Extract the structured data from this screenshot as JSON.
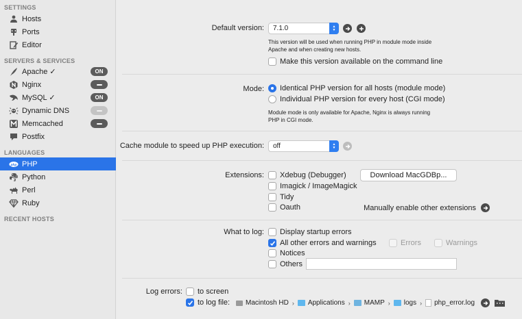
{
  "sidebar": {
    "settings_title": "SETTINGS",
    "settings_items": [
      {
        "label": "Hosts",
        "icon": "hosts-icon"
      },
      {
        "label": "Ports",
        "icon": "ports-icon"
      },
      {
        "label": "Editor",
        "icon": "editor-icon"
      }
    ],
    "servers_title": "SERVERS & SERVICES",
    "servers": [
      {
        "label": "Apache ✓",
        "status": "ON"
      },
      {
        "label": "Nginx",
        "status": ""
      },
      {
        "label": "MySQL ✓",
        "status": "ON"
      },
      {
        "label": "Dynamic DNS",
        "status": ""
      },
      {
        "label": "Memcached",
        "status": ""
      },
      {
        "label": "Postfix",
        "status": ""
      }
    ],
    "languages_title": "LANGUAGES",
    "languages": [
      {
        "label": "PHP",
        "icon_text": "php"
      },
      {
        "label": "Python"
      },
      {
        "label": "Perl"
      },
      {
        "label": "Ruby"
      }
    ],
    "recent_title": "RECENT HOSTS"
  },
  "php": {
    "default_version_label": "Default version:",
    "default_version_value": "7.1.0",
    "default_version_help_1": "This version will be used when running PHP in module mode inside",
    "default_version_help_2": "Apache and when creating new hosts.",
    "cli_checkbox": "Make this version available on the command line",
    "mode_label": "Mode:",
    "mode_options": [
      "Identical PHP version for all hosts (module mode)",
      "Individual PHP version for every host (CGI mode)"
    ],
    "mode_selected": 0,
    "mode_help_1": "Module mode is only available for Apache, Nginx is always running",
    "mode_help_2": "PHP in CGI mode.",
    "cache_label": "Cache module to speed up PHP execution:",
    "cache_value": "off",
    "extensions_label": "Extensions:",
    "extensions": [
      {
        "label": "Xdebug (Debugger)",
        "checked": false
      },
      {
        "label": "Imagick / ImageMagick",
        "checked": false
      },
      {
        "label": "Tidy",
        "checked": false
      },
      {
        "label": "Oauth",
        "checked": false
      }
    ],
    "download_button": "Download MacGDBp...",
    "manual_extensions": "Manually enable other extensions",
    "log_label": "What to log:",
    "log_options": [
      {
        "label": "Display startup errors",
        "checked": false
      },
      {
        "label": "All other errors and warnings",
        "checked": true
      },
      {
        "label": "Notices",
        "checked": false
      },
      {
        "label": "Others",
        "checked": false
      }
    ],
    "log_sub_errors": "Errors",
    "log_sub_warnings": "Warnings",
    "others_value": "",
    "log_errors_label": "Log errors:",
    "to_screen": "to screen",
    "to_screen_checked": false,
    "to_log_file": "to log file:",
    "to_log_file_checked": true,
    "path": [
      "Macintosh HD",
      "Applications",
      "MAMP",
      "logs",
      "php_error.log"
    ]
  },
  "colors": {
    "accent": "#2a74e8",
    "sidebar_bg": "#e8e8e8",
    "main_bg": "#ececec"
  }
}
